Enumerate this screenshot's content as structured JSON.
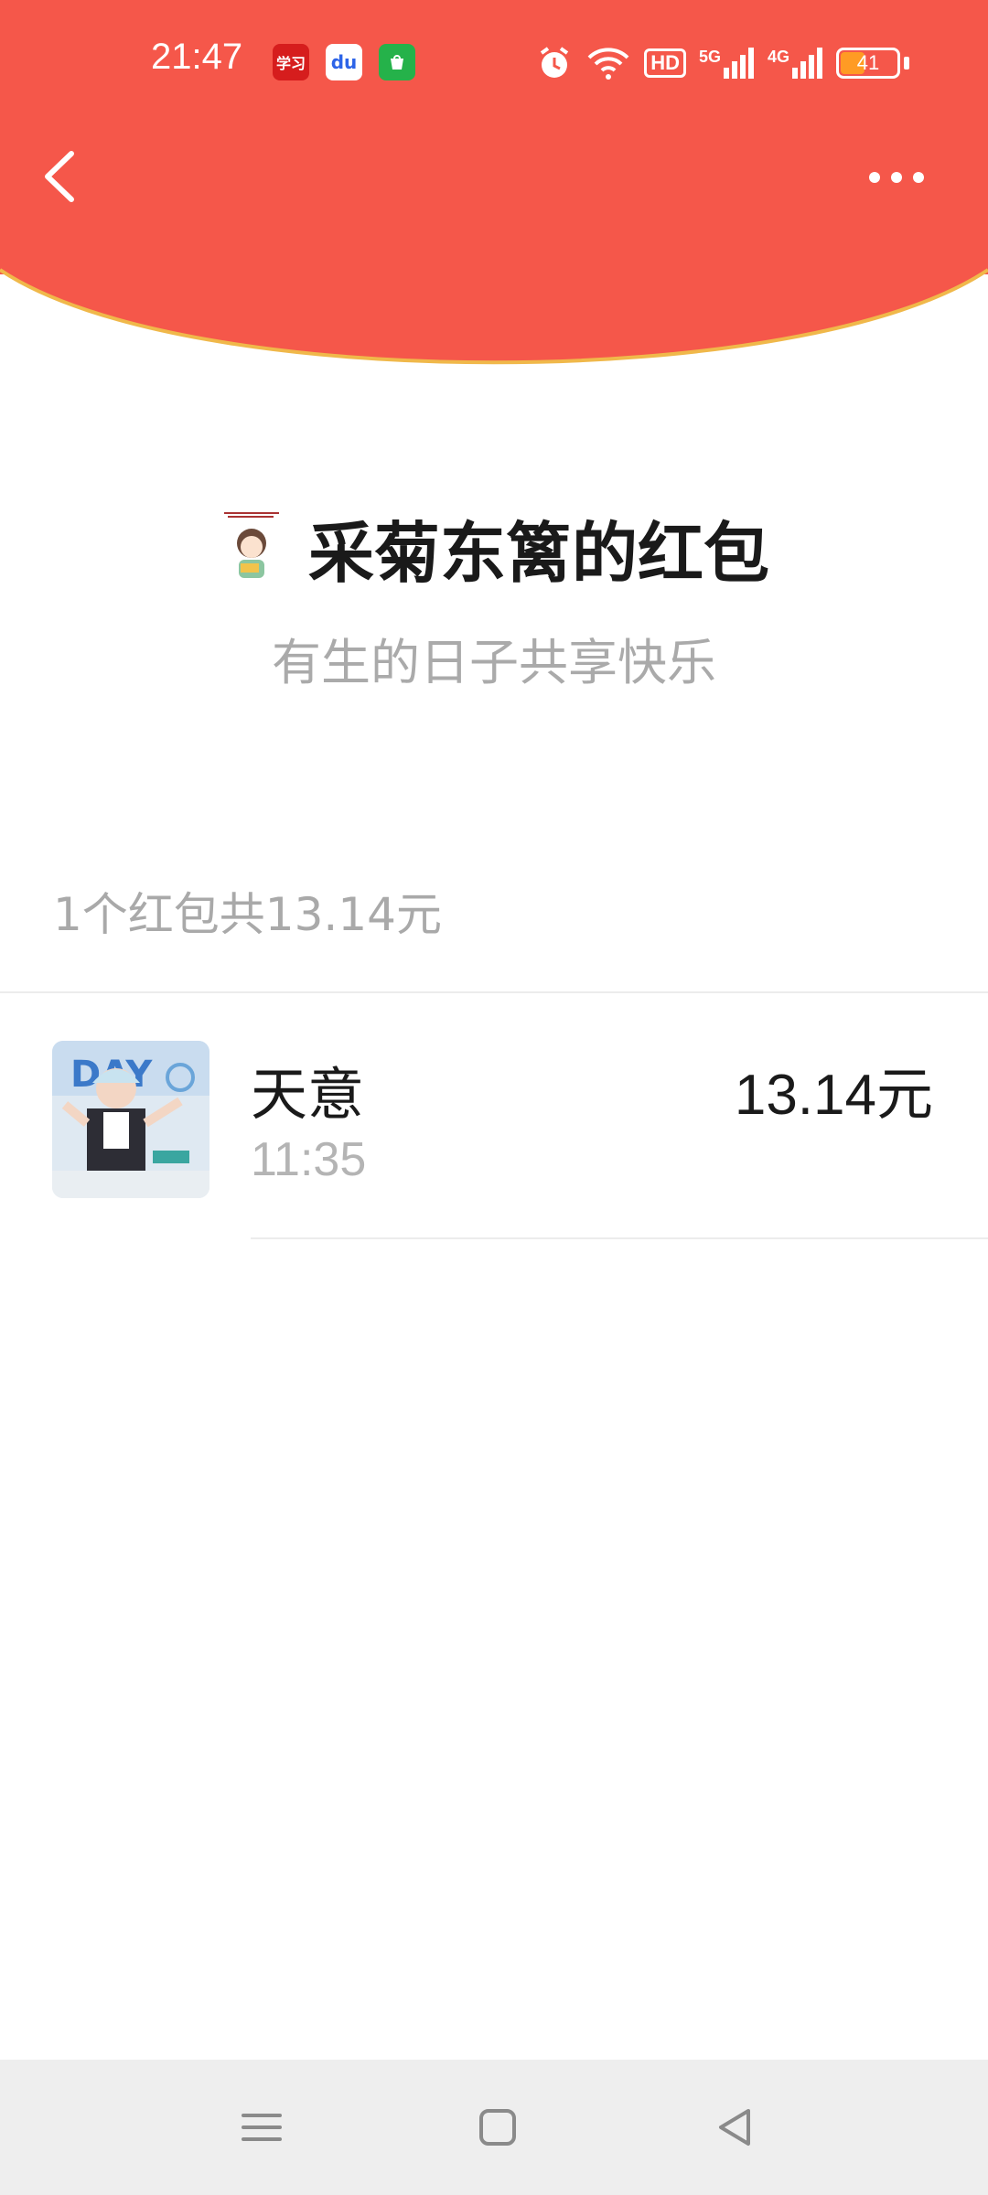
{
  "status_bar": {
    "time": "21:47",
    "app_icons": [
      "xuexi-icon",
      "baidu-icon",
      "shop-icon"
    ],
    "xuexi_label": "学习",
    "baidu_label": "du",
    "network": [
      "alarm-icon",
      "wifi-icon",
      "hd-icon",
      "5g-signal-icon",
      "4g-signal-icon"
    ],
    "hd_label": "HD",
    "five_g_label": "5G",
    "four_g_label": "4G",
    "battery_level": "41"
  },
  "header": {
    "back_icon": "chevron-left-icon",
    "more_icon": "more-dots-icon",
    "accent_color": "#f5574a"
  },
  "envelope": {
    "title": "采菊东篱的红包",
    "subtitle": "有生的日子共享快乐"
  },
  "summary": "1个红包共13.14元",
  "records": [
    {
      "name": "天意",
      "time": "11:35",
      "amount": "13.14元"
    }
  ],
  "nav_bar": {
    "icons": [
      "menu-icon",
      "home-square-icon",
      "back-triangle-icon"
    ]
  }
}
